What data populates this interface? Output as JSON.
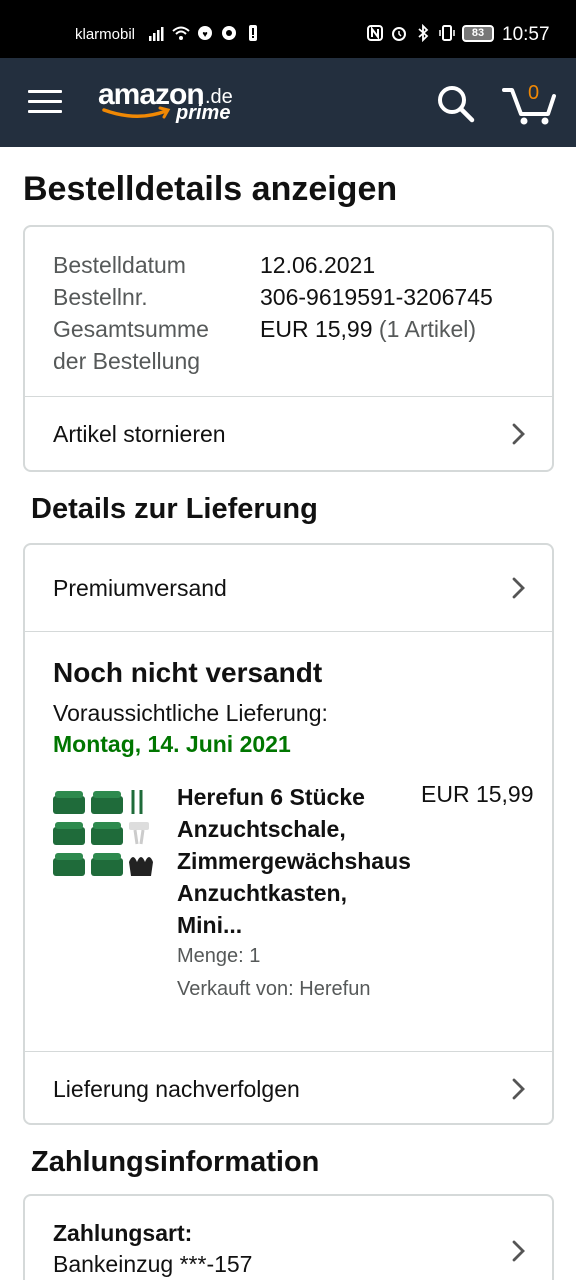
{
  "status_bar": {
    "carrier": "klarmobil",
    "battery": "83",
    "time": "10:57"
  },
  "header": {
    "logo_main": "amazon",
    "logo_tld": ".de",
    "logo_sub": "prime",
    "cart_count": "0",
    "accent_color": "#f08804",
    "background_color": "#232f3e"
  },
  "page": {
    "title": "Bestelldetails anzeigen"
  },
  "order_summary": {
    "date_label": "Bestelldatum",
    "date_value": "12.06.2021",
    "number_label": "Bestellnr.",
    "number_value": "306-9619591-3206745",
    "total_label_line1": "Gesamtsumme",
    "total_label_line2": "der Bestellung",
    "total_value": "EUR 15,99",
    "total_items": "(1 Artikel)",
    "cancel_label": "Artikel stornieren"
  },
  "delivery": {
    "section_title": "Details zur Lieferung",
    "shipping_method": "Premiumversand",
    "status": "Noch nicht versandt",
    "estimate_label": "Voraussichtliche Lieferung:",
    "estimate_date": "Montag, 14. Juni 2021",
    "estimate_color": "#007600",
    "track_label": "Lieferung nachverfolgen"
  },
  "item": {
    "title_lines": [
      "Herefun 6 Stücke",
      "Anzuchtschale,",
      "Zimmergewächshaus",
      "Anzuchtkasten,",
      "Mini..."
    ],
    "price": "EUR 15,99",
    "quantity": "Menge: 1",
    "seller": "Verkauft von: Herefun",
    "thumbnail_icon": "seed-tray-set-image"
  },
  "payment": {
    "section_title": "Zahlungsinformation",
    "method_label": "Zahlungsart:",
    "method_value": "Bankeinzug ***-157"
  }
}
